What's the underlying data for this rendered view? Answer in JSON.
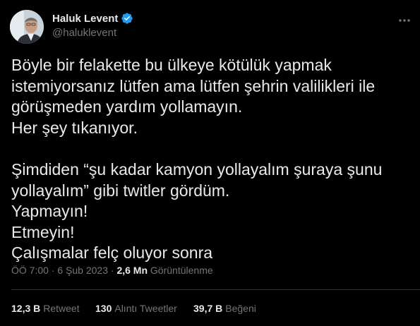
{
  "author": {
    "name": "Haluk Levent",
    "handle": "@haluklevent",
    "verified_color": "#1d9bf0"
  },
  "tweet": {
    "lines": [
      "Böyle bir felakette bu ülkeye kötülük yapmak",
      "istemiyorsanız lütfen ama lütfen şehrin valilikleri ile",
      "görüşmeden yardım yollamayın.",
      "Her şey tıkanıyor.",
      "",
      "Şimdiden “şu kadar kamyon yollayalım şuraya şunu",
      "yollayalım” gibi twitler gördüm.",
      "Yapmayın!",
      "Etmeyin!",
      "Çalışmalar felç oluyor sonra"
    ]
  },
  "meta": {
    "time": "ÖÖ 7:00",
    "separator": "·",
    "date": "6 Şub 2023",
    "views_count": "2,6 Mn",
    "views_label": "Görüntülenme"
  },
  "stats": {
    "retweets_count": "12,3 B",
    "retweets_label": "Retweet",
    "quotes_count": "130",
    "quotes_label": "Alıntı Tweetler",
    "likes_count": "39,7 B",
    "likes_label": "Beğeni"
  },
  "icons": {
    "more": "more-icon",
    "verified": "verified-badge-icon"
  },
  "colors": {
    "background": "#000000",
    "text": "#e7e9ea",
    "secondary": "#71767b",
    "divider": "#2f3336",
    "accent": "#1d9bf0"
  }
}
